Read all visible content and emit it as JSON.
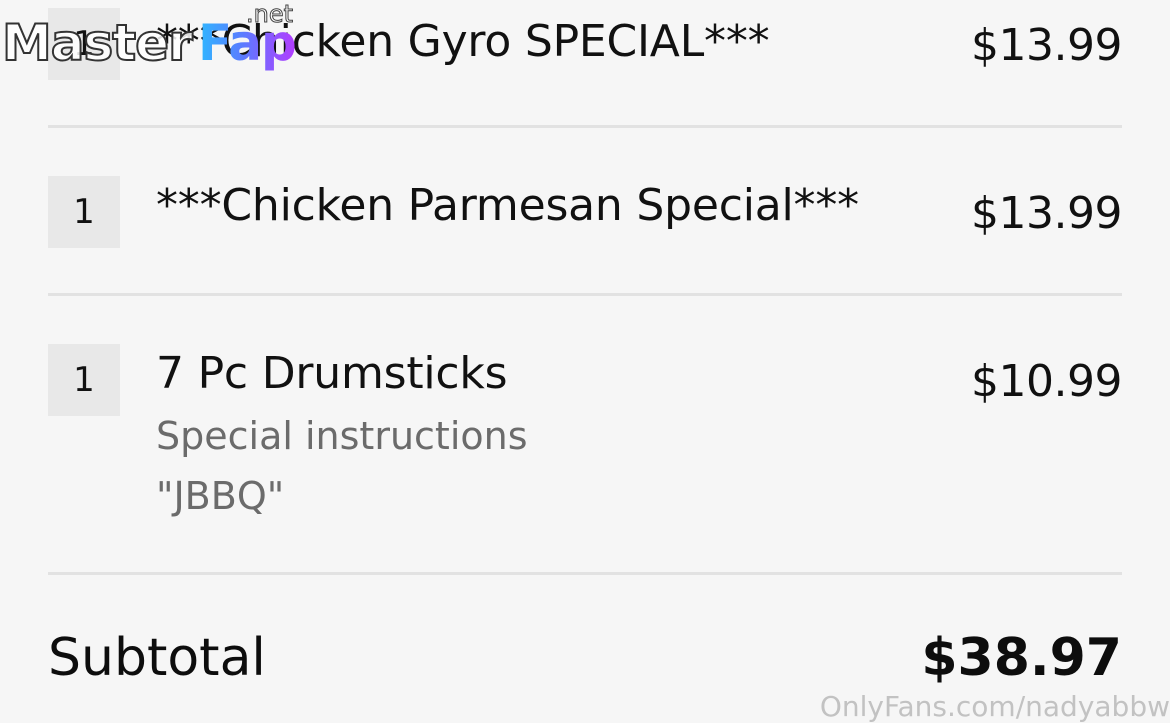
{
  "cart": {
    "items": [
      {
        "quantity": "1",
        "name": "***Chicken Gyro SPECIAL***",
        "price": "$13.99"
      },
      {
        "quantity": "1",
        "name": "***Chicken Parmesan Special***",
        "price": "$13.99"
      },
      {
        "quantity": "1",
        "name": "7 Pc Drumsticks",
        "price": "$10.99",
        "special_instructions_label": "Special instructions",
        "special_instructions_value": "\"JBBQ\""
      }
    ],
    "subtotal_label": "Subtotal",
    "subtotal_value": "$38.97"
  },
  "watermarks": {
    "logo_part1": "Master",
    "logo_part2": "Fap",
    "logo_part3": ".net",
    "url": "OnlyFans.com/nadyabbw"
  }
}
